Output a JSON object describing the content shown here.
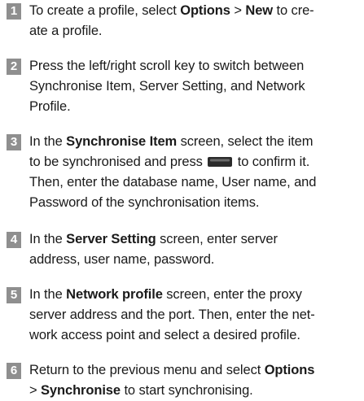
{
  "steps": [
    {
      "number": "1",
      "parts": {
        "t1": "To create a profile, select ",
        "b1": "Options",
        "t2": " > ",
        "b2": "New",
        "t3": " to cre-",
        "t4": "ate a profile."
      }
    },
    {
      "number": "2",
      "parts": {
        "t1": "Press the left/right scroll key to switch between",
        "t2": "Synchronise Item, Server Setting, and Network",
        "t3": "Profile."
      }
    },
    {
      "number": "3",
      "parts": {
        "t1": "In the ",
        "b1": "Synchronise Item",
        "t2": " screen, select the item",
        "t3": "to be synchronised and press ",
        "t4": " to confirm it.",
        "t5": "Then, enter the database name, User name, and",
        "t6": "Password of the synchronisation items."
      },
      "icon": "confirm-key-icon"
    },
    {
      "number": "4",
      "parts": {
        "t1": "In the ",
        "b1": "Server Setting",
        "t2": " screen, enter server",
        "t3": "address,  user name, password."
      }
    },
    {
      "number": "5",
      "parts": {
        "t1": "In the ",
        "b1": "Network profile",
        "t2": " screen, enter the proxy",
        "t3": "server address and the port. Then, enter the net-",
        "t4": "work access point and select a desired profile."
      }
    },
    {
      "number": "6",
      "parts": {
        "t1": "Return to the previous menu and select ",
        "b1": "Options",
        "t2": "> ",
        "b2": "Synchronise",
        "t3": " to start synchronising."
      }
    }
  ],
  "colors": {
    "badge_bg": "#8f8f8f",
    "badge_text": "#ffffff",
    "text": "#1a1a1a"
  }
}
